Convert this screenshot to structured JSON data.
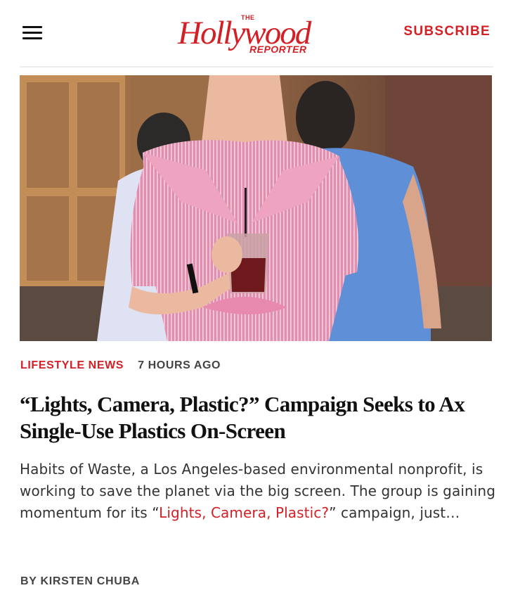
{
  "header": {
    "logo": {
      "top": "THE",
      "word": "Hollywood",
      "bottom": "REPORTER"
    },
    "subscribe_label": "SUBSCRIBE",
    "menu_icon": "hamburger-menu-icon"
  },
  "article": {
    "image_alt": "Woman in a pink striped shirt dress holding a plastic cup with a straw on a city street",
    "category": "LIFESTYLE NEWS",
    "time_ago": "7 HOURS AGO",
    "headline": "“Lights, Camera, Plastic?” Campaign Seeks to Ax Single-Use Plastics On-Screen",
    "excerpt": {
      "text_before": "Habits of Waste, a Los Angeles-based environmental nonprofit, is working to save the planet via the big screen. The group is gaining momentum for its ",
      "quote_open": "“",
      "highlight": "Lights, Camera, Plastic?",
      "text_after": "” campaign, just…"
    },
    "byline_prefix": "BY",
    "author": "KIRSTEN CHUBA"
  },
  "colors": {
    "brand_red": "#d32027",
    "text": "#222222",
    "muted": "#444444"
  }
}
